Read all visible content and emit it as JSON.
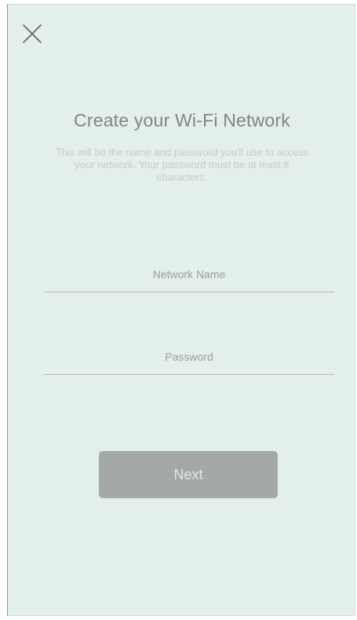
{
  "header": {
    "close_icon": "close-icon"
  },
  "content": {
    "title": "Create your Wi-Fi Network",
    "subtitle": "This will be the name and password you'll use to access your network. Your password must be at least 8 characters."
  },
  "form": {
    "network_name": {
      "value": "",
      "placeholder": "Network Name"
    },
    "password": {
      "value": "",
      "placeholder": "Password"
    }
  },
  "actions": {
    "next_label": "Next",
    "next_enabled": false
  },
  "colors": {
    "background": "#e2efea",
    "title": "#7f8583",
    "button_disabled": "#a4a9a7"
  }
}
